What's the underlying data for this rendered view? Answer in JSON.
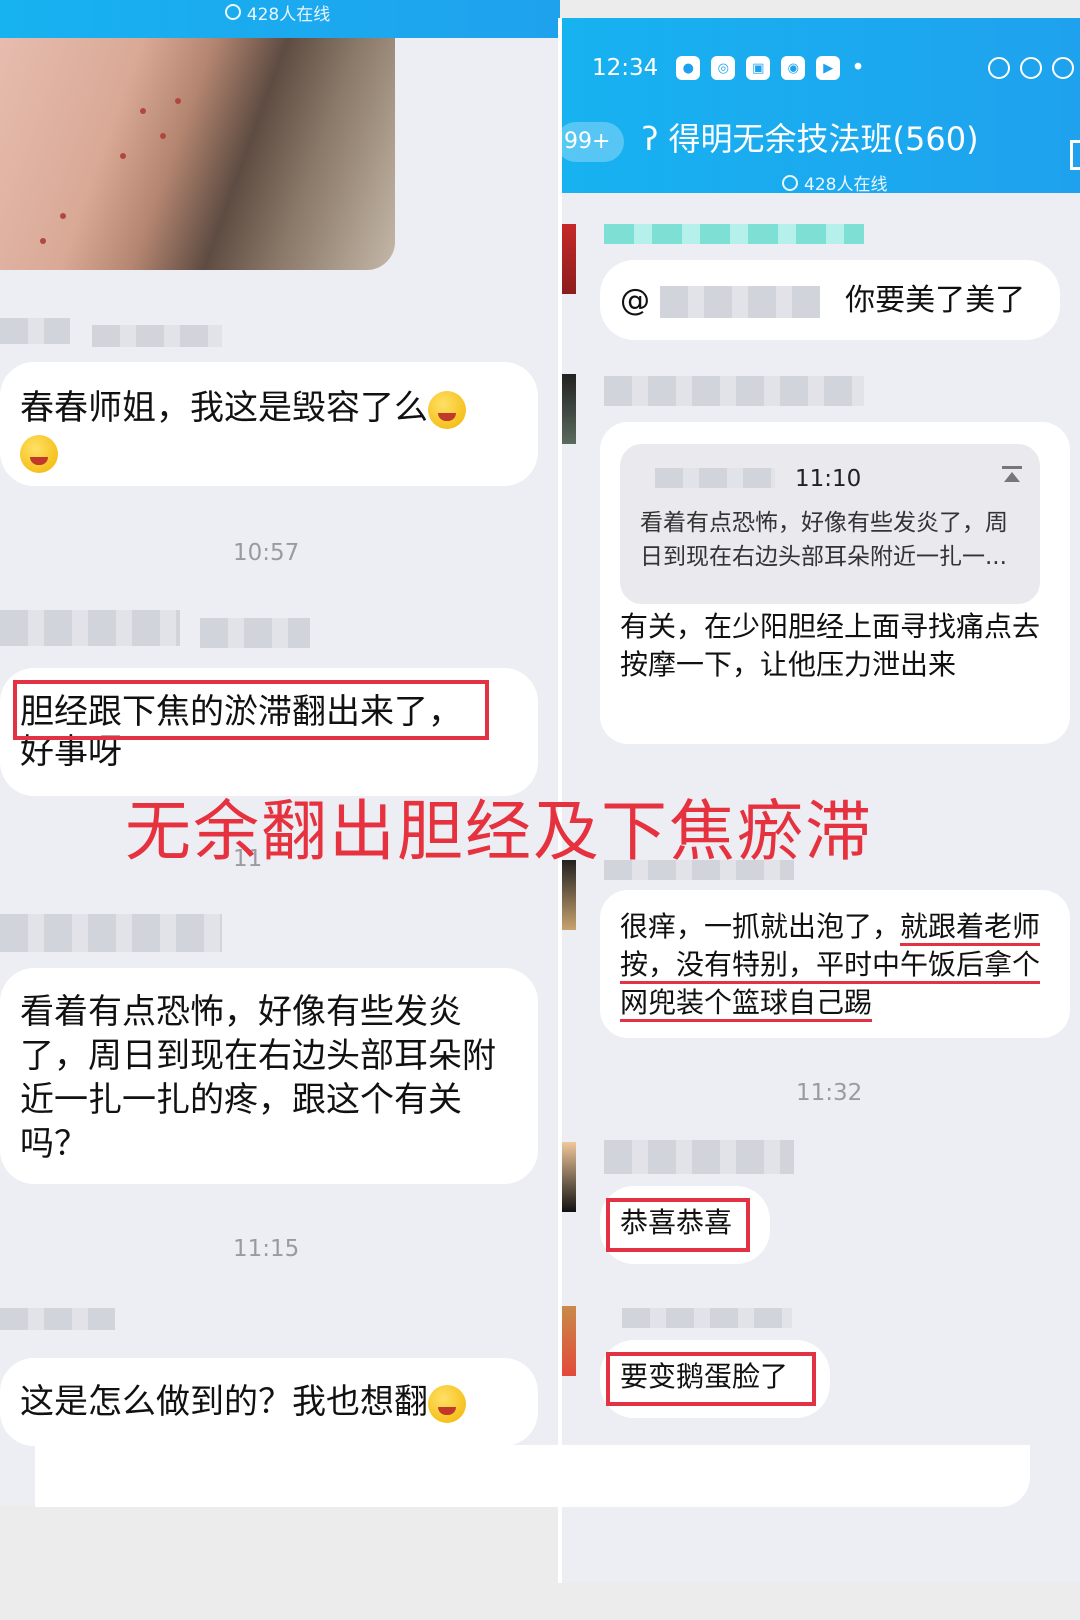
{
  "left": {
    "online": "428人在线",
    "messages": [
      {
        "text": "春春师姐，我这是毁容了么"
      },
      {
        "text": "胆经跟下焦的淤滞翻出来了，",
        "text2": "好事呀"
      },
      {
        "text": "看着有点恐怖，好像有些发炎了，周日到现在右边头部耳朵附近一扎一扎的疼，跟这个有关吗？"
      },
      {
        "text": "这是怎么做到的？我也想翻"
      }
    ],
    "timestamps": [
      "10:57",
      "11",
      "11:15"
    ]
  },
  "right": {
    "status_time": "12:34",
    "back_count": "99+",
    "group_title": "得明无余技法班(560)",
    "online": "428人在线",
    "messages": [
      {
        "prefix": "@",
        "text": "你要美了美了"
      },
      {
        "quote_time": "11:10",
        "quote_text": "看着有点恐怖，好像有些发炎了，周日到现在右边头部耳朵附近一扎一...",
        "text": "有关，在少阳胆经上面寻找痛点去按摩一下，让他压力泄出来"
      },
      {
        "text_a": "很痒，一抓就出泡了，",
        "text_b": "就跟着老师按，没有特别，平时中午饭后拿个网兜装个篮球自己踢"
      },
      {
        "text": "恭喜恭喜"
      },
      {
        "text": "要变鹅蛋脸了"
      }
    ],
    "timestamps": [
      "11:32"
    ]
  },
  "overlay_title": "无余翻出胆经及下焦瘀滞",
  "colors": {
    "accent": "#1fa2ee",
    "highlight": "#e23243",
    "bg": "#edeef3"
  }
}
